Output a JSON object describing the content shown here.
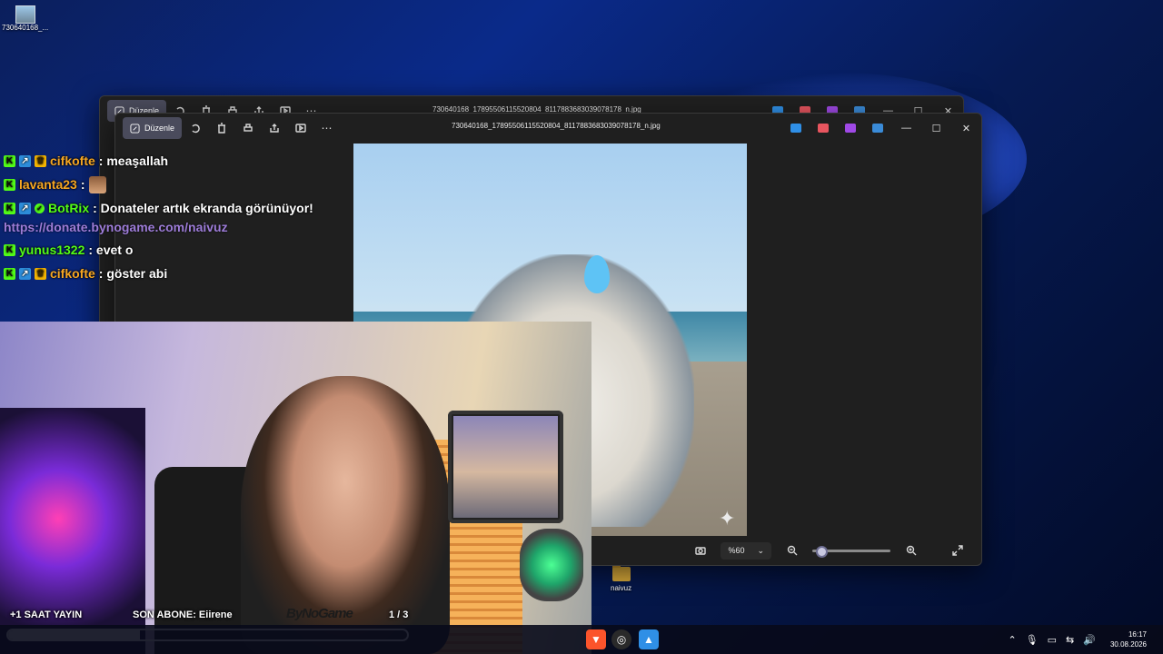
{
  "desktop": {
    "icons": [
      {
        "label": "730640168_..."
      },
      {
        "label": "naivuz"
      }
    ]
  },
  "photos_back": {
    "edit_label": "Düzenle",
    "filename": "730640168_17895506115520804_8117883683039078178_n.jpg"
  },
  "photos_front": {
    "edit_label": "Düzenle",
    "filename": "730640168_17895506115520804_8117883683039078178_n.jpg",
    "zoom_label": "%60",
    "zoom_fraction": 0.06
  },
  "chat": {
    "messages": [
      {
        "user": "cifkofte",
        "user_color": "#f5a623",
        "text": ": meaşallah"
      },
      {
        "user": "lavanta23",
        "user_color": "#f5a623",
        "text": ":"
      },
      {
        "user": "BotRix",
        "user_color": "#53fc18",
        "text": ": Donateler artık ekranda görünüyor!"
      },
      {
        "user": "yunus1322",
        "user_color": "#53fc18",
        "text": ": evet o"
      },
      {
        "user": "cifkofte",
        "user_color": "#f5a623",
        "text": ": göster abi"
      }
    ],
    "link": "https://donate.bynogame.com/naivuz"
  },
  "stream_overlay": {
    "left_text": "+1 SAAT YAYIN",
    "center_text": "SON ABONE: Eiirene",
    "counter": "1 / 3",
    "progress_fraction": 0.33
  },
  "taskbar": {
    "time": "16:17",
    "date": "30.08.2026"
  }
}
